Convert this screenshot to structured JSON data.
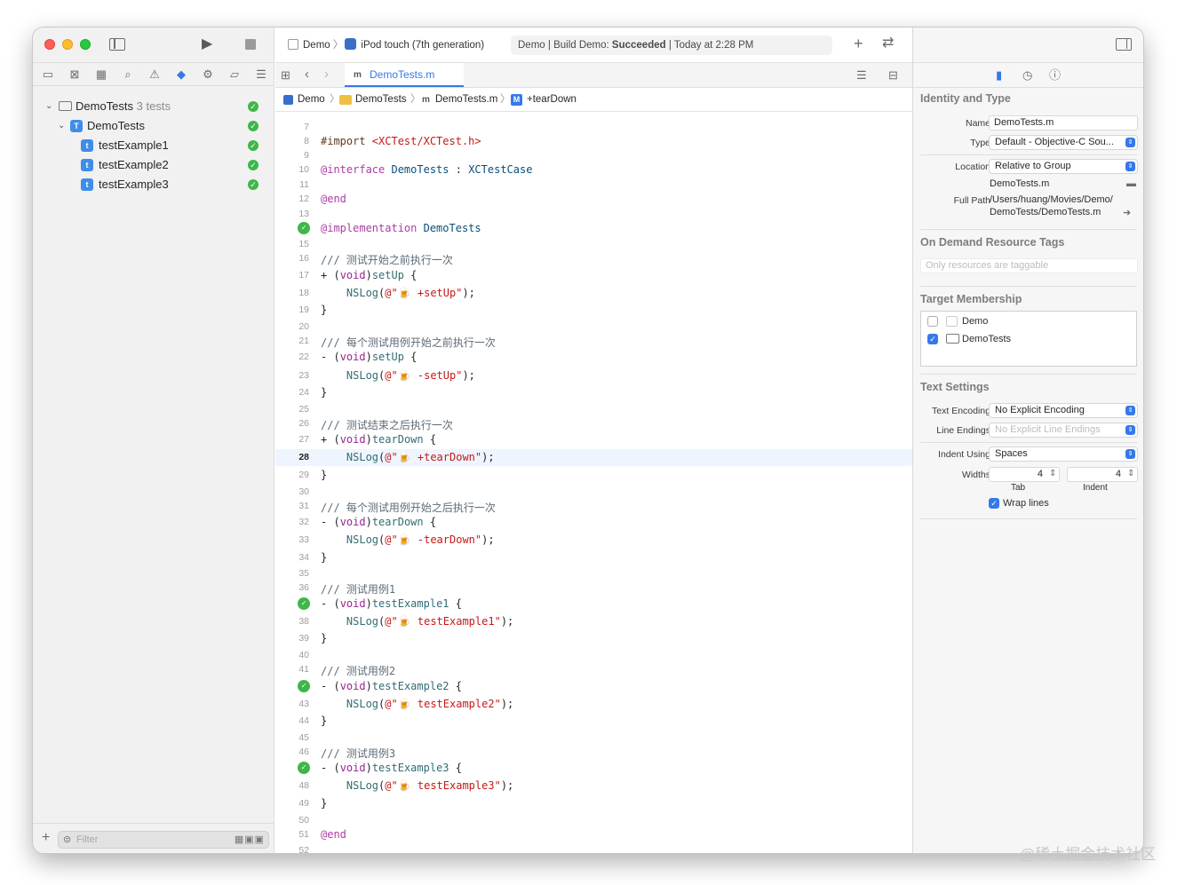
{
  "toolbar": {
    "scheme": "Demo",
    "destination": "iPod touch (7th generation)",
    "status_project": "Demo",
    "status_action": "Build Demo:",
    "status_result": "Succeeded",
    "status_time": "Today at 2:28 PM"
  },
  "navigator": {
    "items": [
      {
        "label": "DemoTests",
        "count": "3 tests"
      },
      {
        "label": "DemoTests"
      },
      {
        "label": "testExample1"
      },
      {
        "label": "testExample2"
      },
      {
        "label": "testExample3"
      }
    ],
    "filter_placeholder": "Filter"
  },
  "editor": {
    "tab": "DemoTests.m",
    "jump": {
      "project": "Demo",
      "group": "DemoTests",
      "file": "DemoTests.m",
      "method": "+tearDown"
    },
    "lines": [
      {
        "n": "7",
        "t": ""
      },
      {
        "n": "8",
        "t": "#import <XCTest/XCTest.h>"
      },
      {
        "n": "9",
        "t": ""
      },
      {
        "n": "10",
        "t": "@interface DemoTests : XCTestCase"
      },
      {
        "n": "11",
        "t": ""
      },
      {
        "n": "12",
        "t": "@end"
      },
      {
        "n": "13",
        "t": ""
      },
      {
        "n": "14",
        "t": "@implementation DemoTests"
      },
      {
        "n": "15",
        "t": ""
      },
      {
        "n": "16",
        "t": "/// 测试开始之前执行一次"
      },
      {
        "n": "17",
        "t": "+ (void)setUp {"
      },
      {
        "n": "18",
        "t": "    NSLog(@\"🍺 +setUp\");"
      },
      {
        "n": "19",
        "t": "}"
      },
      {
        "n": "20",
        "t": ""
      },
      {
        "n": "21",
        "t": "/// 每个测试用例开始之前执行一次"
      },
      {
        "n": "22",
        "t": "- (void)setUp {"
      },
      {
        "n": "23",
        "t": "    NSLog(@\"🍺 -setUp\");"
      },
      {
        "n": "24",
        "t": "}"
      },
      {
        "n": "25",
        "t": ""
      },
      {
        "n": "26",
        "t": "/// 测试结束之后执行一次"
      },
      {
        "n": "27",
        "t": "+ (void)tearDown {"
      },
      {
        "n": "28",
        "t": "    NSLog(@\"🍺 +tearDown\");"
      },
      {
        "n": "29",
        "t": "}"
      },
      {
        "n": "30",
        "t": ""
      },
      {
        "n": "31",
        "t": "/// 每个测试用例开始之后执行一次"
      },
      {
        "n": "32",
        "t": "- (void)tearDown {"
      },
      {
        "n": "33",
        "t": "    NSLog(@\"🍺 -tearDown\");"
      },
      {
        "n": "34",
        "t": "}"
      },
      {
        "n": "35",
        "t": ""
      },
      {
        "n": "36",
        "t": "/// 测试用例1"
      },
      {
        "n": "37",
        "t": "- (void)testExample1 {"
      },
      {
        "n": "38",
        "t": "    NSLog(@\"🍺 testExample1\");"
      },
      {
        "n": "39",
        "t": "}"
      },
      {
        "n": "40",
        "t": ""
      },
      {
        "n": "41",
        "t": "/// 测试用例2"
      },
      {
        "n": "42",
        "t": "- (void)testExample2 {"
      },
      {
        "n": "43",
        "t": "    NSLog(@\"🍺 testExample2\");"
      },
      {
        "n": "44",
        "t": "}"
      },
      {
        "n": "45",
        "t": ""
      },
      {
        "n": "46",
        "t": "/// 测试用例3"
      },
      {
        "n": "47",
        "t": "- (void)testExample3 {"
      },
      {
        "n": "48",
        "t": "    NSLog(@\"🍺 testExample3\");"
      },
      {
        "n": "49",
        "t": "}"
      },
      {
        "n": "50",
        "t": ""
      },
      {
        "n": "51",
        "t": "@end"
      },
      {
        "n": "52",
        "t": ""
      }
    ],
    "current_line": "28",
    "test_passed_lines": [
      "14",
      "37",
      "42",
      "47"
    ]
  },
  "inspector": {
    "identity_title": "Identity and Type",
    "name_label": "Name",
    "name_value": "DemoTests.m",
    "type_label": "Type",
    "type_value": "Default - Objective-C Sou...",
    "location_label": "Location",
    "location_value": "Relative to Group",
    "location_file": "DemoTests.m",
    "fullpath_label": "Full Path",
    "fullpath_line1": "/Users/huang/Movies/Demo/",
    "fullpath_line2": "DemoTests/DemoTests.m",
    "odr_title": "On Demand Resource Tags",
    "odr_placeholder": "Only resources are taggable",
    "target_title": "Target Membership",
    "targets": [
      {
        "label": "Demo",
        "checked": false
      },
      {
        "label": "DemoTests",
        "checked": true
      }
    ],
    "text_title": "Text Settings",
    "encoding_label": "Text Encoding",
    "encoding_value": "No Explicit Encoding",
    "endings_label": "Line Endings",
    "endings_value": "No Explicit Line Endings",
    "indent_label": "Indent Using",
    "indent_value": "Spaces",
    "widths_label": "Widths",
    "tab_value": "4",
    "indent_width_value": "4",
    "tab_caption": "Tab",
    "indent_caption": "Indent",
    "wrap_label": "Wrap lines"
  },
  "watermark": "@稀土掘金技术社区"
}
